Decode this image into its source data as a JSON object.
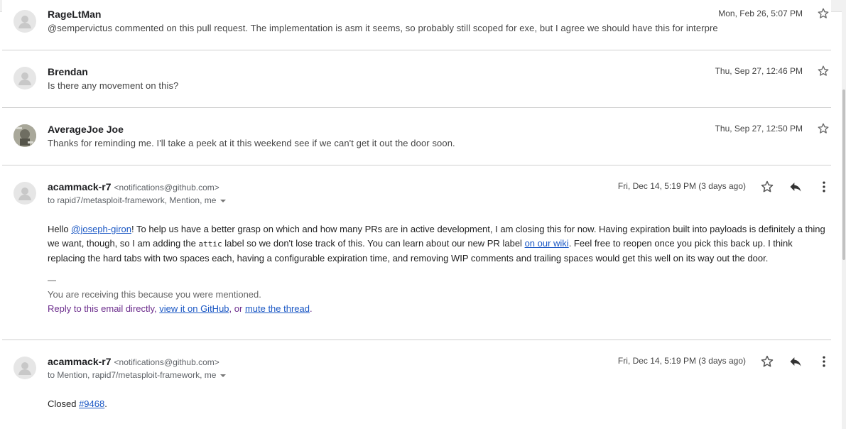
{
  "messages": [
    {
      "sender": "RageLtMan",
      "snippet": "@sempervictus commented on this pull request. The implementation is asm it seems, so probably still scoped for exe, but I agree we should have this for interpre",
      "date": "Mon, Feb 26, 5:07 PM"
    },
    {
      "sender": "Brendan",
      "snippet": "Is there any movement on this?",
      "date": "Thu, Sep 27, 12:46 PM"
    },
    {
      "sender": "AverageJoe Joe",
      "snippet": "Thanks for reminding me. I'll take a peek at it this weekend see if we can't get it out the door soon.",
      "date": "Thu, Sep 27, 12:50 PM"
    }
  ],
  "expanded": [
    {
      "sender": "acammack-r7",
      "email": "<notifications@github.com>",
      "to": "to rapid7/metasploit-framework, Mention, me",
      "date": "Fri, Dec 14, 5:19 PM (3 days ago)",
      "body": {
        "p1": "Hello ",
        "mention": "@joseph-giron",
        "p2": "! To help us have a better grasp on which and how many PRs are in active development, I am closing this for now. Having expiration built into payloads is definitely a thing",
        "p3": "we want, though, so I am adding the ",
        "code": "attic",
        "p4": " label so we don't lose track of this. You can learn about our new PR label ",
        "wiki_link": "on our wiki",
        "p5": ". Feel free to reopen once you pick this back up. I think",
        "p6": "replacing the hard tabs with two spaces each, having a configurable expiration time, and removing WIP comments and trailing spaces would get this well on its way out the door."
      },
      "sig_dash": "—",
      "receiving": "You are receiving this because you were mentioned.",
      "reply_text": "Reply to this email directly, ",
      "view_link": "view it on GitHub",
      "or_text": ", or ",
      "mute_link": "mute the thread",
      "end": "."
    },
    {
      "sender": "acammack-r7",
      "email": "<notifications@github.com>",
      "to": "to Mention, rapid7/metasploit-framework, me",
      "date": "Fri, Dec 14, 5:19 PM (3 days ago)",
      "closed_text": "Closed ",
      "pr_link": "#9468",
      "end": "."
    }
  ],
  "icons": {
    "star": "star-icon",
    "reply": "reply-icon",
    "more": "more-vert-icon",
    "avatar": "default-avatar-icon"
  }
}
